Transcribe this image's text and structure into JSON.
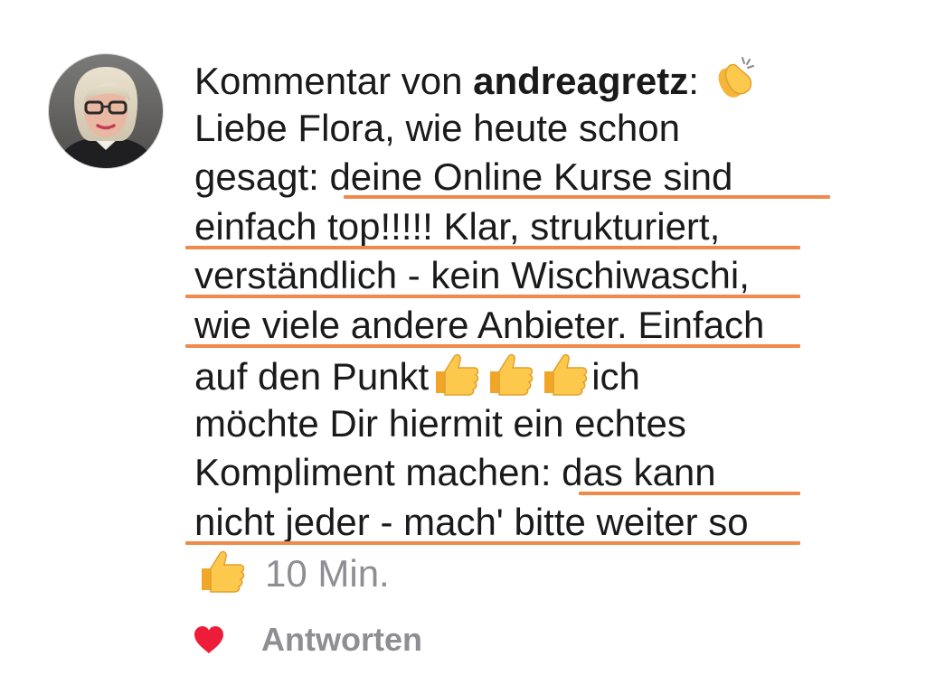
{
  "comment": {
    "prefix": "Kommentar von ",
    "username": "andreagretz",
    "colon": ":",
    "lines": [
      "Liebe Flora, wie heute schon",
      "gesagt: deine Online Kurse sind",
      "einfach top!!!!! Klar, strukturiert,",
      "verständlich - kein Wischiwaschi,",
      "wie viele andere Anbieter. Einfach",
      "auf den Punkt",
      "ich",
      "möchte Dir hiermit ein echtes",
      "Kompliment machen: das kann",
      "nicht jeder - mach' bitte weiter so"
    ],
    "timestamp": "10 Min.",
    "emoji_after_username": "clapping-hands",
    "emoji_thumbs_count": 3,
    "emoji_final": "thumbs-up"
  },
  "actions": {
    "like_icon": "heart-icon",
    "reply_label": "Antworten"
  },
  "colors": {
    "underline": "#f08a4b",
    "heart": "#ed1d3a",
    "muted": "#8e8e93",
    "text": "#1a1a1a"
  }
}
